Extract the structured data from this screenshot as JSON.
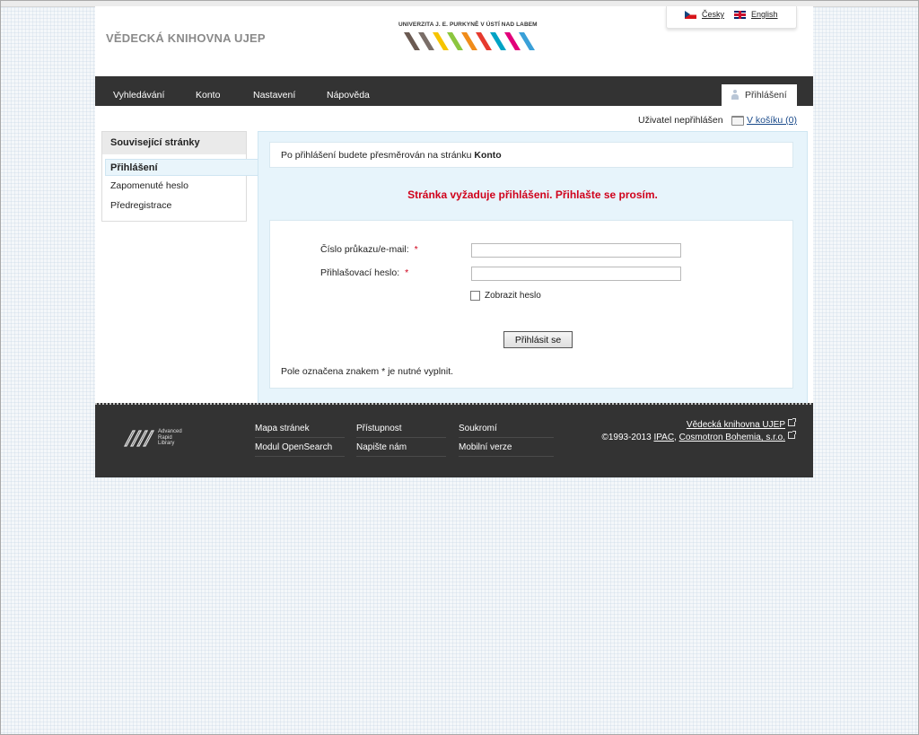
{
  "header": {
    "library_title": "VĚDECKÁ KNIHOVNA UJEP",
    "logo_text": "UNIVERZITA J. E. PURKYNĚ V ÚSTÍ NAD LABEM",
    "logo_stripe_colors": [
      "#6b5a52",
      "#7a6e68",
      "#f6c400",
      "#8cc63f",
      "#f08c1a",
      "#e63a2e",
      "#00a3c4",
      "#e2007a",
      "#3aa0d8"
    ],
    "languages": [
      {
        "label": "Česky",
        "flag": "cz-flag"
      },
      {
        "label": "English",
        "flag": "uk-flag"
      }
    ]
  },
  "nav": {
    "items": [
      "Vyhledávání",
      "Konto",
      "Nastavení",
      "Nápověda"
    ],
    "login_tab": "Přihlášení"
  },
  "user_bar": {
    "status": "Uživatel nepřihlášen",
    "cart_link": "V košíku (0)"
  },
  "sidebar": {
    "heading": "Související stránky",
    "active_item": "Přihlášení",
    "items": [
      "Zapomenuté heslo",
      "Předregistrace"
    ]
  },
  "main": {
    "info_text": "Po přihlášení budete přesměrován na stránku",
    "info_target": "Konto",
    "warning": "Stránka vyžaduje přihlášeni. Přihlašte se prosím.",
    "form": {
      "card_label": "Číslo průkazu/e-mail:",
      "password_label": "Přihlašovací heslo:",
      "required_marker": "*",
      "card_value": "",
      "password_value": "",
      "show_password_label": "Zobrazit heslo",
      "show_password_checked": false,
      "submit_label": "Přihlásit se",
      "required_note": "Pole označena znakem * je nutné vyplnit."
    }
  },
  "footer": {
    "logo_text": [
      "Advanced",
      "Rapid",
      "Library"
    ],
    "links": [
      "Mapa stránek",
      "Přístupnost",
      "Soukromí",
      "Modul OpenSearch",
      "Napište nám",
      "Mobilní verze"
    ],
    "library_link": "Vědecká knihovna UJEP",
    "copyright_prefix": "©1993-2013",
    "ipac_link": "IPAC",
    "separator": ",",
    "cosmotron_link": "Cosmotron Bohemia, s.r.o."
  },
  "colors": {
    "nav_background": "#333333",
    "warning": "#d0021b",
    "content_panel": "#e7f4fb",
    "link": "#1a4a8a"
  }
}
